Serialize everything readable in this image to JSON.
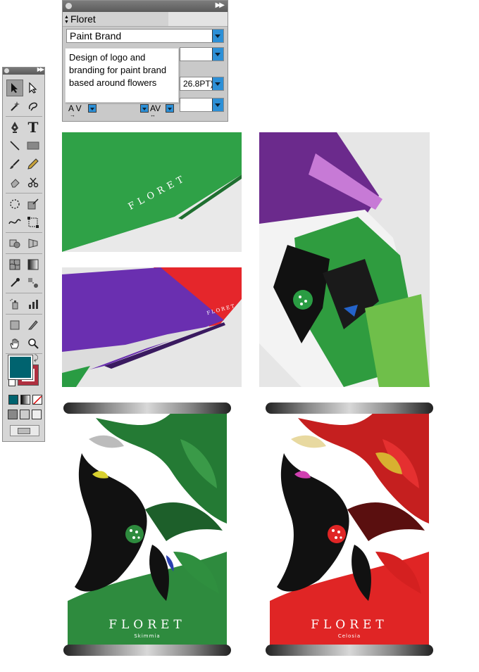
{
  "character_panel": {
    "tab_label": "Floret",
    "font_field": "Paint Brand",
    "size_field": "26.8PT)",
    "tooltip_text": "Design of logo and branding for paint brand based around flowers",
    "kerning_label": "A V",
    "tracking_label": "AV"
  },
  "tools_panel": {
    "type_tool_glyph": "T"
  },
  "photos": {
    "green_card_text": "FLORET",
    "swatch_card_text": "FLORET"
  },
  "cans": [
    {
      "brand": "FLORET",
      "variant": "Skimmia",
      "color": "#2e8b3e"
    },
    {
      "brand": "FLORET",
      "variant": "Celosia",
      "color": "#e02525"
    }
  ],
  "colors": {
    "fill_swatch": "#00636f",
    "stroke_swatch": "#b03040",
    "dropdown_accent": "#2c8fd6"
  }
}
